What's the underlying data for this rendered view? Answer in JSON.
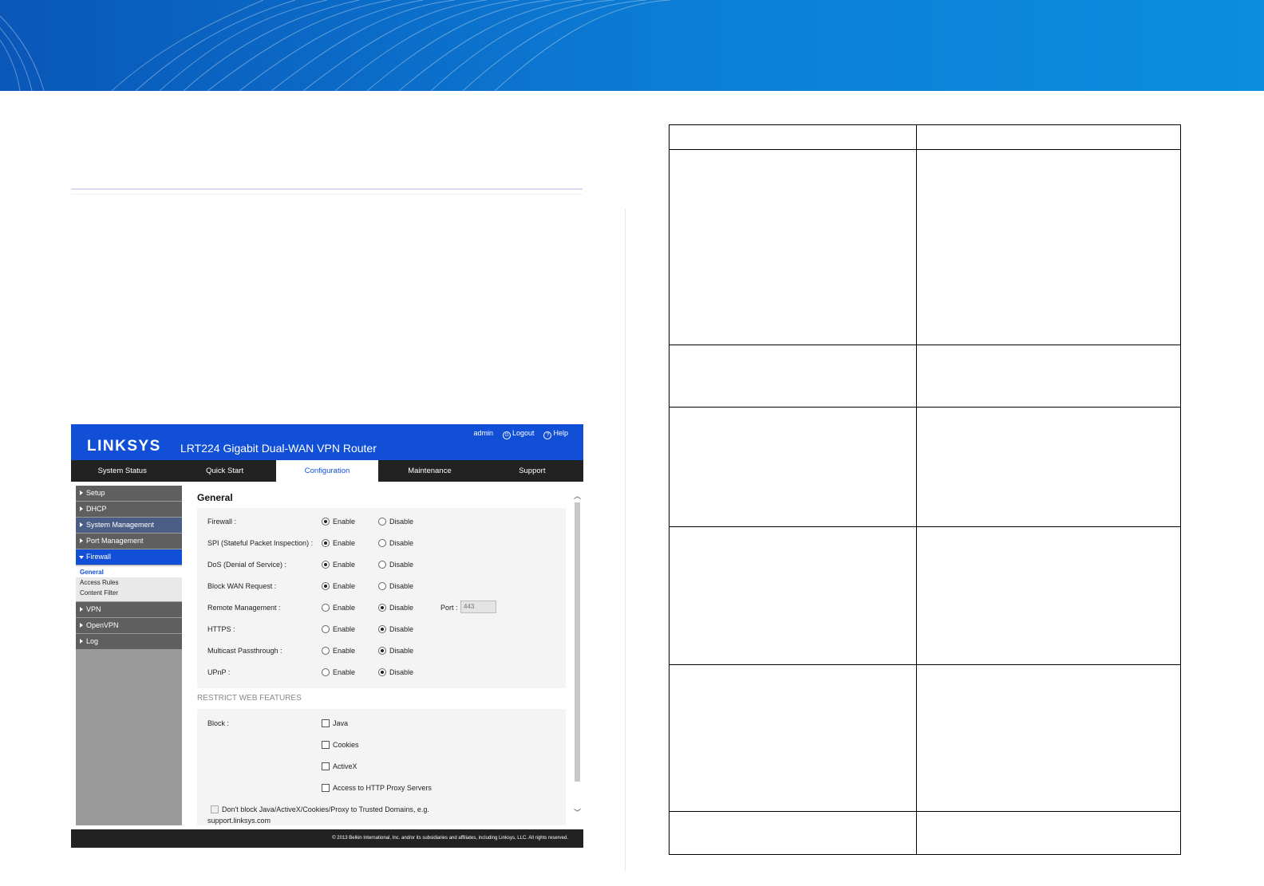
{
  "router_ui": {
    "logo": "LINKSYS",
    "product_title": "LRT224  Gigabit Dual-WAN VPN Router",
    "top_links": {
      "user": "admin",
      "logout": "Logout",
      "help": "Help"
    },
    "nav_tabs": [
      "System Status",
      "Quick Start",
      "Configuration",
      "Maintenance",
      "Support"
    ],
    "active_tab": "Configuration",
    "sidebar": {
      "items_top": [
        "Setup",
        "DHCP",
        "System Management",
        "Port Management",
        "Firewall"
      ],
      "sub_items": [
        "General",
        "Access Rules",
        "Content Filter"
      ],
      "items_bottom": [
        "VPN",
        "OpenVPN",
        "Log"
      ]
    },
    "page_title": "General",
    "enable_label": "Enable",
    "disable_label": "Disable",
    "settings": [
      {
        "label": "Firewall :",
        "value": "Enable"
      },
      {
        "label": "SPI (Stateful Packet Inspection) :",
        "value": "Enable"
      },
      {
        "label": "DoS (Denial of Service) :",
        "value": "Enable"
      },
      {
        "label": "Block WAN Request :",
        "value": "Enable"
      },
      {
        "label": "Remote Management :",
        "value": "Disable"
      },
      {
        "label": "HTTPS :",
        "value": "Disable"
      },
      {
        "label": "Multicast Passthrough :",
        "value": "Disable"
      },
      {
        "label": "UPnP :",
        "value": "Disable"
      }
    ],
    "port_label": "Port :",
    "port_value": "443",
    "restrict_heading": "RESTRICT WEB FEATURES",
    "block_label": "Block :",
    "block_options": [
      "Java",
      "Cookies",
      "ActiveX",
      "Access to HTTP Proxy Servers"
    ],
    "trusted_domains_line1": "Don't block Java/ActiveX/Cookies/Proxy to Trusted Domains, e.g.",
    "trusted_domains_line2": "support.linksys.com",
    "footer": "© 2013 Belkin International, Inc. and/or its subsidiaries and affiliates, including Linksys, LLC. All rights reserved."
  },
  "colors": {
    "banner": "#0c7ed6",
    "router_header": "#1150d6",
    "navbar": "#222222",
    "sidebar_item": "#5f5f5f",
    "sidebar_active": "#1150d6"
  }
}
